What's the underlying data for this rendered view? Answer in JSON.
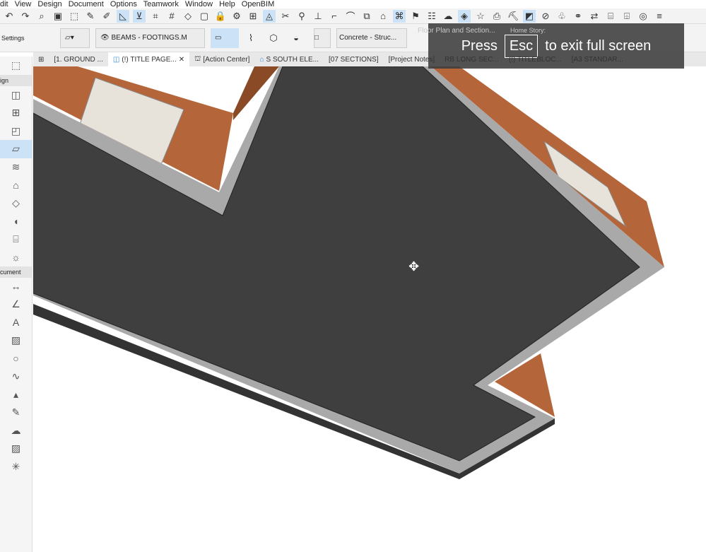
{
  "menu": [
    "dit",
    "View",
    "Design",
    "Document",
    "Options",
    "Teamwork",
    "Window",
    "Help",
    "OpenBIM"
  ],
  "infobox": {
    "settings_label": "Settings",
    "layer": "BEAMS - FOOTINGS.M",
    "material": "Concrete - Struc...",
    "floor_plan": "Floor Plan and Section...",
    "home_story": "Home Story:"
  },
  "tabs": [
    {
      "label": "[1. GROUND ..."
    },
    {
      "label": "(!) TITLE PAGE...",
      "active": true
    },
    {
      "label": "[Action Center]"
    },
    {
      "label": "S SOUTH ELE..."
    },
    {
      "label": "[07 SECTIONS]"
    },
    {
      "label": "[Project Notes]"
    },
    {
      "label": "RB LONG SEC..."
    },
    {
      "label": "(!) TITLEBLOC..."
    },
    {
      "label": "[A3 STANDAR..."
    }
  ],
  "toolbox": {
    "design_label": "ign",
    "document_label": "cument"
  },
  "overlay": {
    "press": "Press",
    "key": "Esc",
    "rest": "to exit full screen"
  },
  "colors": {
    "slab": "#3f3f3f",
    "edge": "#a9a9a9",
    "brick": "#b5653a",
    "selected": "#cce3f7"
  }
}
